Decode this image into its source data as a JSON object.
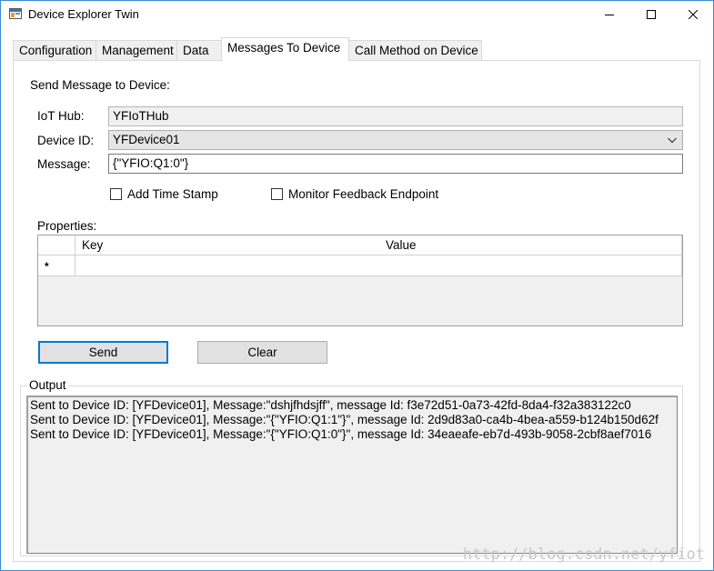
{
  "window": {
    "title": "Device Explorer Twin",
    "icon": "app-window-icon",
    "controls": {
      "minimize": "minimize-icon",
      "maximize": "maximize-icon",
      "close": "close-icon"
    }
  },
  "tabs": [
    {
      "label": "Configuration",
      "active": false
    },
    {
      "label": "Management",
      "active": false
    },
    {
      "label": "Data",
      "active": false
    },
    {
      "label": "Messages To Device",
      "active": true
    },
    {
      "label": "Call Method on Device",
      "active": false
    }
  ],
  "section_title": "Send Message to Device:",
  "form": {
    "iothub_label": "IoT Hub:",
    "iothub_value": "YFIoTHub",
    "device_label": "Device ID:",
    "device_value": "YFDevice01",
    "message_label": "Message:",
    "message_value": "{\"YFIO:Q1:0\"}",
    "add_timestamp_label": "Add Time Stamp",
    "add_timestamp_checked": false,
    "monitor_feedback_label": "Monitor Feedback Endpoint",
    "monitor_feedback_checked": false
  },
  "properties": {
    "label": "Properties:",
    "columns": [
      "Key",
      "Value"
    ],
    "new_row_marker": "*"
  },
  "buttons": {
    "send": "Send",
    "clear": "Clear"
  },
  "output": {
    "label": "Output",
    "lines": [
      "Sent to Device ID: [YFDevice01], Message:\"dshjfhdsjff\", message Id: f3e72d51-0a73-42fd-8da4-f32a383122c0",
      "Sent to Device ID: [YFDevice01], Message:\"{\"YFIO:Q1:1\"}\", message Id: 2d9d83a0-ca4b-4bea-a559-b124b150d62f",
      "Sent to Device ID: [YFDevice01], Message:\"{\"YFIO:Q1:0\"}\", message Id: 34eaeafe-eb7d-493b-9058-2cbf8aef7016"
    ]
  },
  "watermark": "http://blog.csdn.net/yfiot",
  "colors": {
    "window_border": "#3c89d8",
    "default_button_border": "#0078d7",
    "panel_bg": "#f0f0f0"
  }
}
